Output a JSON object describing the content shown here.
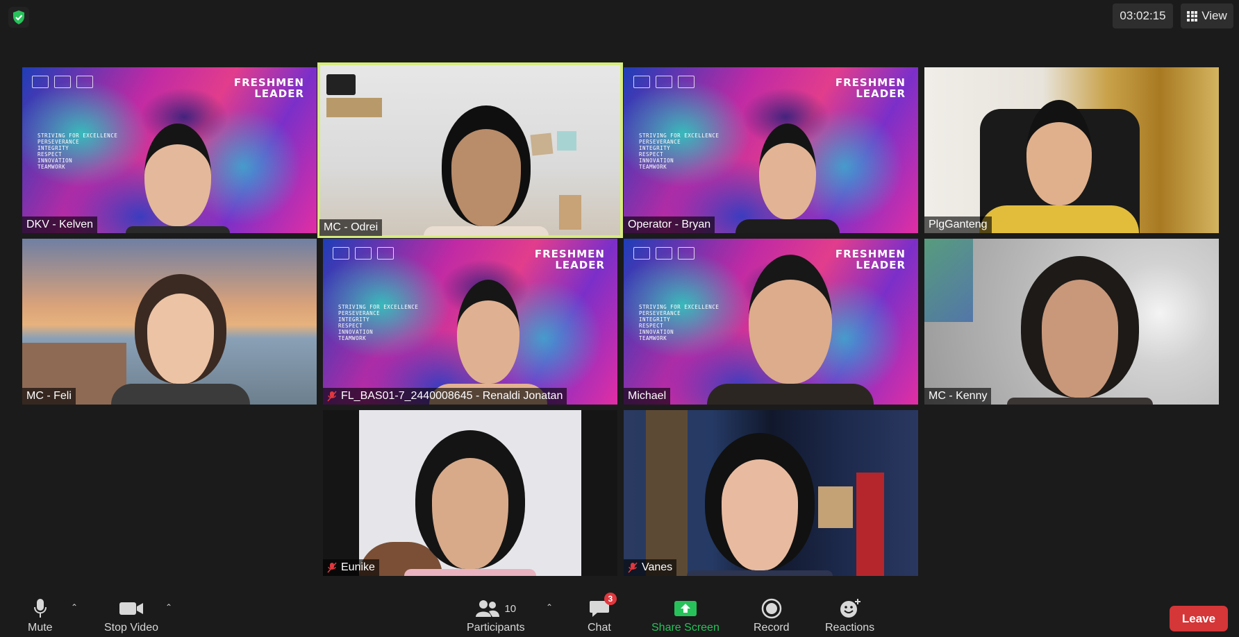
{
  "top_bar": {
    "security_icon": "shield-check-icon",
    "timer": "03:02:15",
    "view_label": "View"
  },
  "tiles": [
    {
      "name": "DKV - Kelven",
      "muted": false,
      "background": "freshmen-leader"
    },
    {
      "name": "MC - Odrei",
      "muted": false,
      "background": "room",
      "active_speaker": true
    },
    {
      "name": "Operator - Bryan",
      "muted": false,
      "background": "freshmen-leader"
    },
    {
      "name": "PlgGanteng",
      "muted": false,
      "background": "room-curtain"
    },
    {
      "name": "MC - Feli",
      "muted": false,
      "background": "bridge"
    },
    {
      "name": "FL_BAS01-7_2440008645 - Renaldi Jonatan",
      "muted": true,
      "background": "freshmen-leader"
    },
    {
      "name": "Michael",
      "muted": false,
      "background": "freshmen-leader"
    },
    {
      "name": "MC - Kenny",
      "muted": false,
      "background": "blurred"
    },
    {
      "name": "Eunike",
      "muted": true,
      "background": "wall"
    },
    {
      "name": "Vanes",
      "muted": true,
      "background": "space"
    }
  ],
  "freshmen_leader": {
    "title_line1": "FRESHMEN",
    "title_line2": "LEADER",
    "values": [
      "STRIVING FOR EXCELLENCE",
      "PERSEVERANCE",
      "INTEGRITY",
      "RESPECT",
      "INNOVATION",
      "TEAMWORK"
    ]
  },
  "toolbar": {
    "mute_label": "Mute",
    "stop_video_label": "Stop Video",
    "participants_label": "Participants",
    "participants_count": "10",
    "chat_label": "Chat",
    "chat_badge": "3",
    "share_screen_label": "Share Screen",
    "record_label": "Record",
    "reactions_label": "Reactions",
    "leave_label": "Leave"
  },
  "colors": {
    "background": "#1b1b1b",
    "active_speaker_border": "#d6ec7e",
    "share_green": "#27c25a",
    "leave_red": "#d53638",
    "badge_red": "#e0383e"
  }
}
